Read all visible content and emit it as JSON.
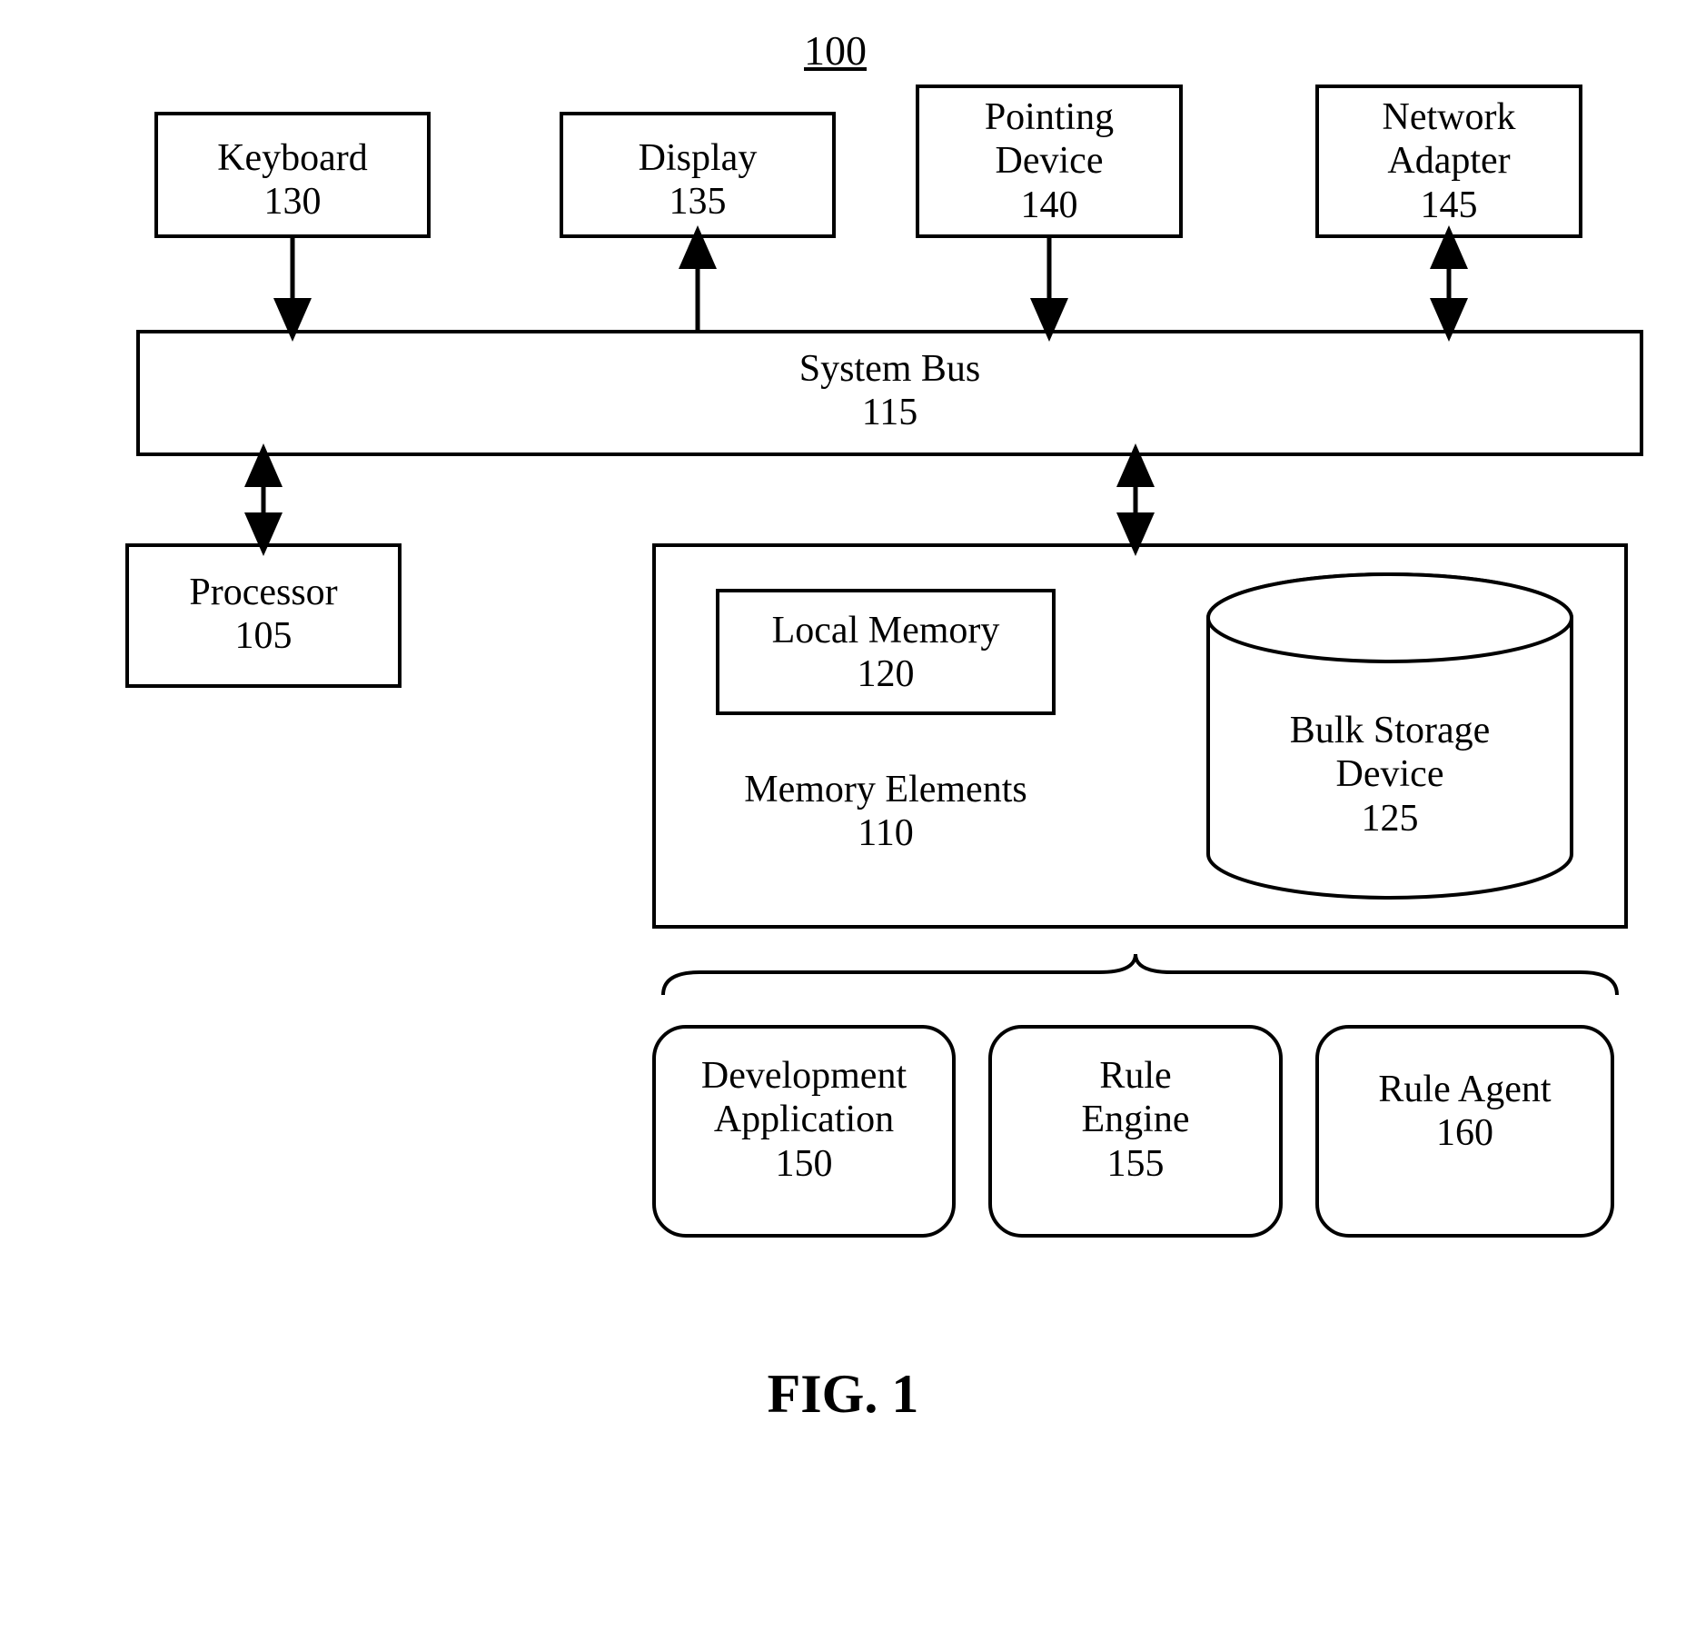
{
  "figure": {
    "number_label": "100",
    "caption": "FIG. 1"
  },
  "blocks": {
    "keyboard": {
      "label": "Keyboard\n130"
    },
    "display": {
      "label": "Display\n135"
    },
    "pointing_device": {
      "label": "Pointing\nDevice\n140"
    },
    "network_adapter": {
      "label": "Network\nAdapter\n145"
    },
    "system_bus": {
      "label": "System Bus\n115"
    },
    "processor": {
      "label": "Processor\n105"
    },
    "local_memory": {
      "label": "Local Memory\n120"
    },
    "memory_elements": {
      "label": "Memory Elements\n110"
    },
    "bulk_storage": {
      "label": "Bulk Storage\nDevice\n125"
    },
    "dev_app": {
      "label": "Development\nApplication\n150"
    },
    "rule_engine": {
      "label": "Rule\nEngine\n155"
    },
    "rule_agent": {
      "label": "Rule Agent\n160"
    }
  }
}
